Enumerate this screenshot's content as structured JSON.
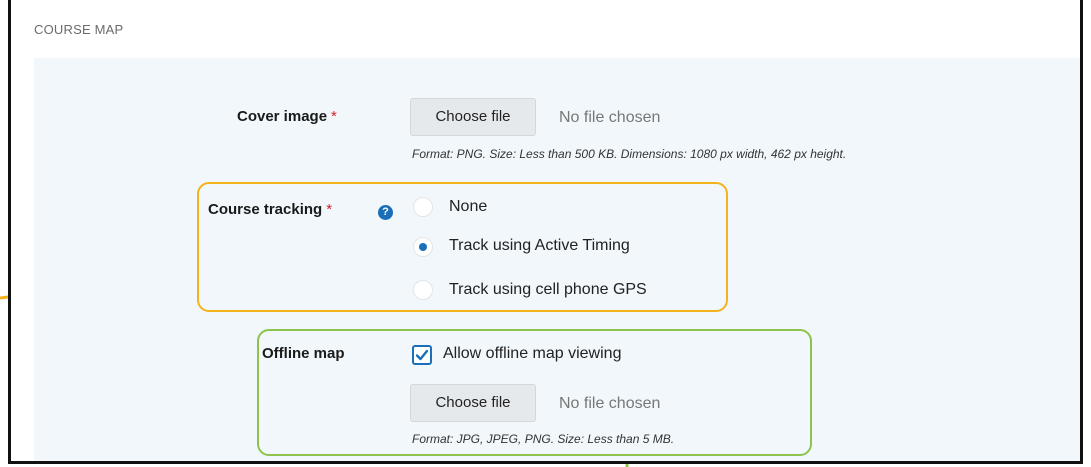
{
  "section": {
    "title": "COURSE MAP"
  },
  "cover_image": {
    "label": "Cover image",
    "required_mark": "*",
    "button_label": "Choose file",
    "status": "No file chosen",
    "hint": "Format: PNG. Size: Less than 500 KB. Dimensions: 1080 px width, 462 px height."
  },
  "course_tracking": {
    "label": "Course tracking",
    "required_mark": "*",
    "help_icon": "?",
    "options": [
      {
        "label": "None",
        "selected": false
      },
      {
        "label": "Track using Active Timing",
        "selected": true
      },
      {
        "label": "Track using cell phone GPS",
        "selected": false
      }
    ]
  },
  "offline_map": {
    "label": "Offline map",
    "checkbox_label": "Allow offline map viewing",
    "checked": true,
    "button_label": "Choose file",
    "status": "No file chosen",
    "hint": "Format: JPG, JPEG, PNG. Size: Less than 5 MB."
  },
  "colors": {
    "accent": "#1b6fb8",
    "required": "#d0232b",
    "callout_orange": "#f5b31b",
    "callout_green": "#8cc44b",
    "panel_bg": "#f1f7fb"
  }
}
